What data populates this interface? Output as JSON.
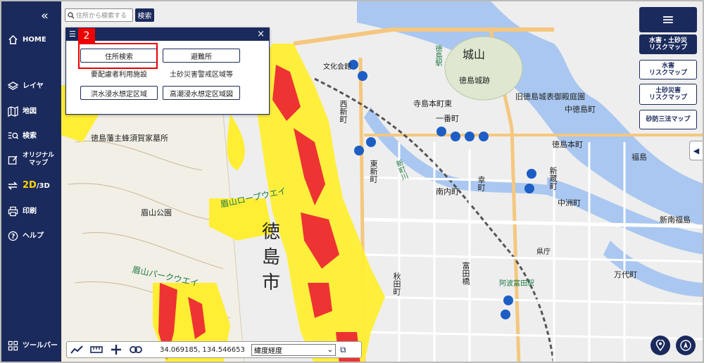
{
  "sidebar": {
    "collapse_glyph": "«",
    "items": [
      {
        "label": "HOME",
        "icon": "home-icon"
      },
      {
        "label": "レイヤ",
        "icon": "layers-icon"
      },
      {
        "label": "地図",
        "icon": "map-icon"
      },
      {
        "label": "検索",
        "icon": "search-list-icon"
      },
      {
        "label": "オリジナル\nマップ",
        "icon": "edit-icon"
      },
      {
        "label_2d": "2D",
        "label_3d": "/3D",
        "icon": "swap-icon"
      },
      {
        "label": "印刷",
        "icon": "print-icon"
      },
      {
        "label": "ヘルプ",
        "icon": "help-icon"
      }
    ],
    "toolbar_label": "ツールバー"
  },
  "search": {
    "placeholder": "住所から検索する",
    "button": "検索"
  },
  "popup": {
    "buttons": [
      "住所検索",
      "避難所",
      "要配慮者利用施設",
      "土砂災害警戒区域等",
      "洪水浸水想定区域",
      "高潮浸水想定区域図"
    ],
    "close": "×",
    "step_number": "2"
  },
  "right_panel": {
    "menu_glyph": "≡",
    "buttons": [
      {
        "label": "水害・土砂災\nリスクマップ",
        "active": true
      },
      {
        "label": "水害\nリスクマップ",
        "active": false
      },
      {
        "label": "土砂災害\nリスクマップ",
        "active": false
      },
      {
        "label": "砂防三法マップ",
        "active": false
      }
    ],
    "toggle_glyph": "◀"
  },
  "toolbar": {
    "coords": "34.069185, 134.546653",
    "coord_format": "緯度経度"
  },
  "map_labels": {
    "city_big": [
      "徳",
      "島",
      "市"
    ],
    "castle": "城山",
    "tokushima_station": "徳島駅",
    "castle_ruins": "徳島城跡",
    "museum": "旧徳島城表御殿庭園",
    "bizan_park": "眉山公園",
    "ropeway": "眉山ロープウエイ",
    "parkway": "眉山パークウエイ",
    "tomb": "徳島藩主蜂須賀家墓所",
    "awa_tomida": "阿波富田駅",
    "shinmachi_river": "新町川",
    "kenchou": "県庁",
    "tokushimahonmachi": "徳島本町",
    "shinkura": "新蔵町",
    "minaminai": "南内町",
    "higashishinmachi": "東新町",
    "nishishinmachi": "西新町",
    "tomidabashi": "富田橋",
    "akitamachi": "秋田町",
    "shinminami_fukushima": "新南福島",
    "mandai": "万代町",
    "nakasu": "中洲町",
    "hyougi": "中徳島町",
    "shiroyama_station_area": "寺島本町東",
    "ichibancho": "一番町",
    "fukushima": "福島",
    "bunka": "文化会館",
    "sakura": "幸町"
  },
  "colors": {
    "nav_bg": "#1b2a5c",
    "hazard_yellow": "#ffee33",
    "hazard_red": "#ee3333",
    "water": "#a9c7f0",
    "accent_red": "#ee0000"
  }
}
